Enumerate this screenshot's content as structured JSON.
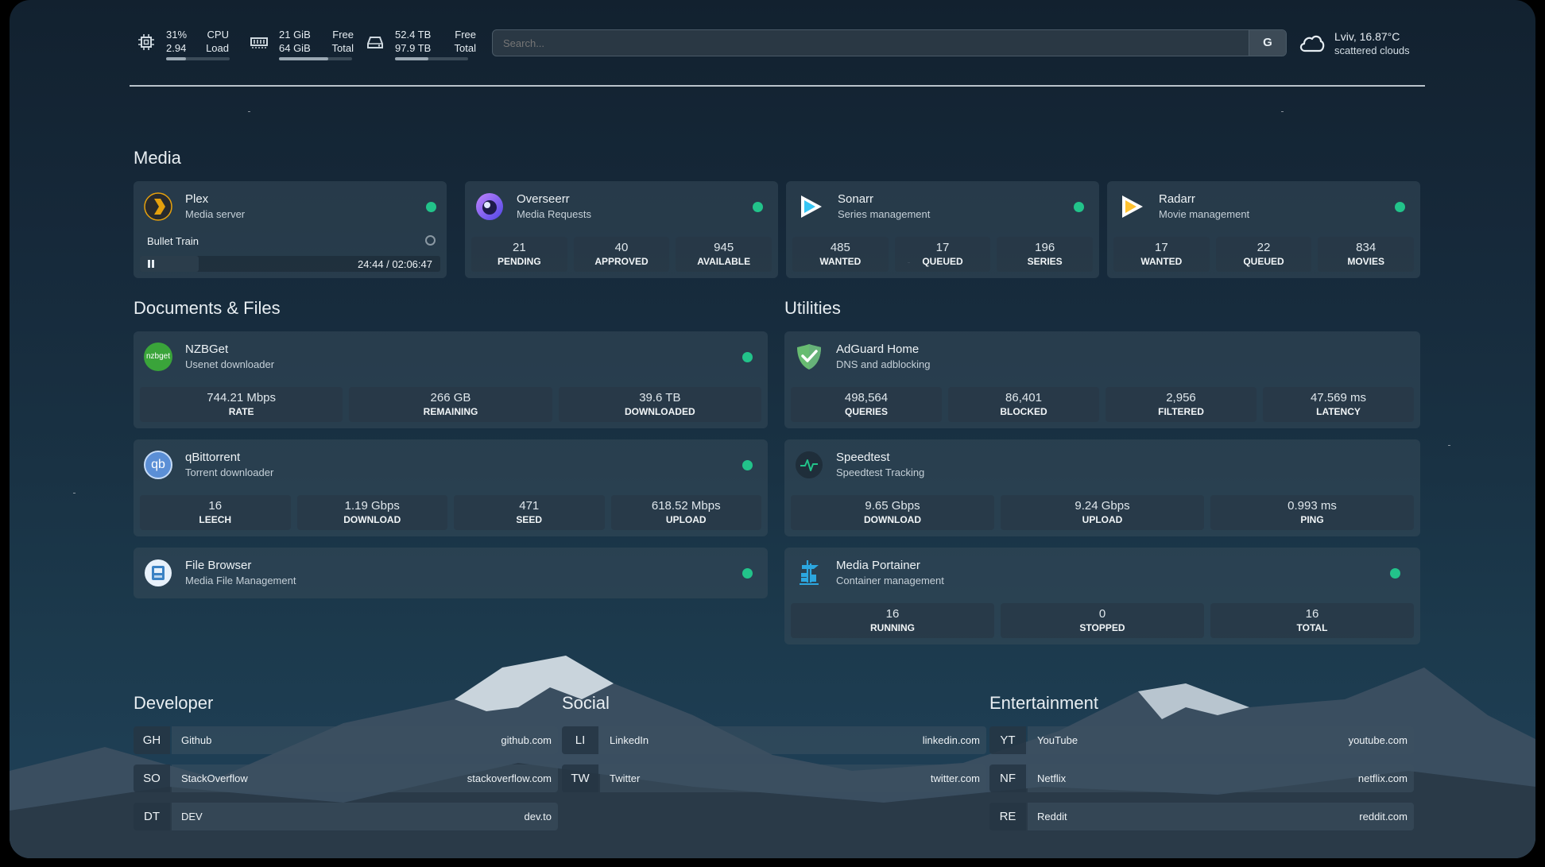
{
  "topbar": {
    "cpu": {
      "percent": "31%",
      "load": "2.94",
      "label1": "CPU",
      "label2": "Load",
      "usage_fraction": 0.31
    },
    "memory": {
      "free": "21 GiB",
      "total": "64 GiB",
      "label1": "Free",
      "label2": "Total",
      "usage_fraction": 0.67
    },
    "disk": {
      "free": "52.4 TB",
      "total": "97.9 TB",
      "label1": "Free",
      "label2": "Total",
      "usage_fraction": 0.46
    },
    "search": {
      "placeholder": "Search...",
      "provider_label": "G"
    },
    "weather": {
      "line1": "Lviv, 16.87°C",
      "line2": "scattered clouds",
      "icon": "cloud-icon"
    }
  },
  "media": {
    "title": "Media",
    "plex": {
      "name": "Plex",
      "desc": "Media server",
      "now_playing": "Bullet Train",
      "time": "24:44 / 02:06:47",
      "progress_fraction": 0.195
    },
    "overseerr": {
      "name": "Overseerr",
      "desc": "Media Requests",
      "stats": [
        {
          "value": "21",
          "label": "PENDING"
        },
        {
          "value": "40",
          "label": "APPROVED"
        },
        {
          "value": "945",
          "label": "AVAILABLE"
        }
      ]
    },
    "sonarr": {
      "name": "Sonarr",
      "desc": "Series management",
      "stats": [
        {
          "value": "485",
          "label": "WANTED"
        },
        {
          "value": "17",
          "label": "QUEUED"
        },
        {
          "value": "196",
          "label": "SERIES"
        }
      ]
    },
    "radarr": {
      "name": "Radarr",
      "desc": "Movie management",
      "stats": [
        {
          "value": "17",
          "label": "WANTED"
        },
        {
          "value": "22",
          "label": "QUEUED"
        },
        {
          "value": "834",
          "label": "MOVIES"
        }
      ]
    }
  },
  "documents": {
    "title": "Documents & Files",
    "nzbget": {
      "name": "NZBGet",
      "desc": "Usenet downloader",
      "icon_text": "nzbget",
      "stats": [
        {
          "value": "744.21 Mbps",
          "label": "RATE"
        },
        {
          "value": "266 GB",
          "label": "REMAINING"
        },
        {
          "value": "39.6 TB",
          "label": "DOWNLOADED"
        }
      ]
    },
    "qbittorrent": {
      "name": "qBittorrent",
      "desc": "Torrent downloader",
      "icon_text": "qb",
      "stats": [
        {
          "value": "16",
          "label": "LEECH"
        },
        {
          "value": "1.19 Gbps",
          "label": "DOWNLOAD"
        },
        {
          "value": "471",
          "label": "SEED"
        },
        {
          "value": "618.52 Mbps",
          "label": "UPLOAD"
        }
      ]
    },
    "filebrowser": {
      "name": "File Browser",
      "desc": "Media File Management"
    }
  },
  "utilities": {
    "title": "Utilities",
    "adguard": {
      "name": "AdGuard Home",
      "desc": "DNS and adblocking",
      "stats": [
        {
          "value": "498,564",
          "label": "QUERIES"
        },
        {
          "value": "86,401",
          "label": "BLOCKED"
        },
        {
          "value": "2,956",
          "label": "FILTERED"
        },
        {
          "value": "47.569 ms",
          "label": "LATENCY"
        }
      ]
    },
    "speedtest": {
      "name": "Speedtest",
      "desc": "Speedtest Tracking",
      "stats": [
        {
          "value": "9.65 Gbps",
          "label": "DOWNLOAD"
        },
        {
          "value": "9.24 Gbps",
          "label": "UPLOAD"
        },
        {
          "value": "0.993 ms",
          "label": "PING"
        }
      ]
    },
    "portainer": {
      "name": "Media Portainer",
      "desc": "Container management",
      "stats": [
        {
          "value": "16",
          "label": "RUNNING"
        },
        {
          "value": "0",
          "label": "STOPPED"
        },
        {
          "value": "16",
          "label": "TOTAL"
        }
      ]
    }
  },
  "bookmarks": {
    "developer": {
      "title": "Developer",
      "items": [
        {
          "abbr": "GH",
          "name": "Github",
          "url": "github.com"
        },
        {
          "abbr": "SO",
          "name": "StackOverflow",
          "url": "stackoverflow.com"
        },
        {
          "abbr": "DT",
          "name": "DEV",
          "url": "dev.to"
        }
      ]
    },
    "social": {
      "title": "Social",
      "items": [
        {
          "abbr": "LI",
          "name": "LinkedIn",
          "url": "linkedin.com"
        },
        {
          "abbr": "TW",
          "name": "Twitter",
          "url": "twitter.com"
        }
      ]
    },
    "entertainment": {
      "title": "Entertainment",
      "items": [
        {
          "abbr": "YT",
          "name": "YouTube",
          "url": "youtube.com"
        },
        {
          "abbr": "NF",
          "name": "Netflix",
          "url": "netflix.com"
        },
        {
          "abbr": "RE",
          "name": "Reddit",
          "url": "reddit.com"
        }
      ]
    }
  },
  "colors": {
    "status_online": "#22c38a",
    "accent_sonarr": "#35c5f4",
    "accent_radarr": "#ffc230",
    "accent_plex": "#e5a00d",
    "accent_overseerr": "#6366f1"
  }
}
